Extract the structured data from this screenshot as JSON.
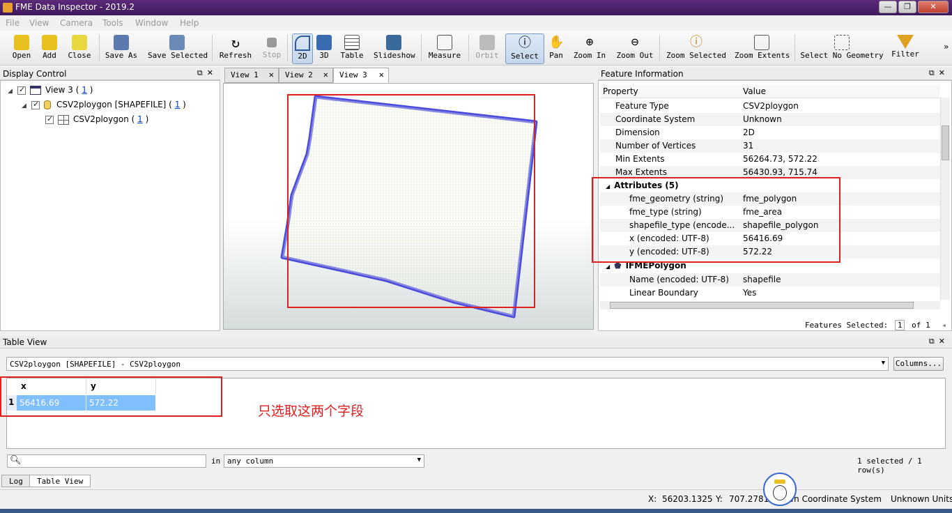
{
  "window": {
    "title": "FME Data Inspector - 2019.2",
    "min": "—",
    "max": "❐",
    "close": "✕"
  },
  "menu": [
    "File",
    "View",
    "Camera",
    "Tools",
    "Window",
    "Help"
  ],
  "toolbar": {
    "open": "Open",
    "add": "Add",
    "close": "Close",
    "save_as": "Save As",
    "save_selected": "Save Selected",
    "refresh": "Refresh",
    "stop": "Stop",
    "mode_2d": "2D",
    "mode_3d": "3D",
    "table": "Table",
    "slideshow": "Slideshow",
    "measure": "Measure",
    "orbit": "Orbit",
    "select": "Select",
    "pan": "Pan",
    "zoom_in": "Zoom In",
    "zoom_out": "Zoom Out",
    "zoom_selected": "Zoom Selected",
    "zoom_extents": "Zoom Extents",
    "select_no_geometry": "Select No Geometry",
    "filter": "Filter",
    "more": "»"
  },
  "display_control": {
    "title": "Display Control",
    "view": {
      "name": "View 3 (",
      "count": "1",
      "suffix": ")"
    },
    "dataset": {
      "name": "CSV2ploygon [SHAPEFILE] (",
      "count": "1",
      "suffix": ")"
    },
    "featuretype": {
      "name": "CSV2ploygon (",
      "count": "1",
      "suffix": ")"
    }
  },
  "view_tabs": [
    "View 1",
    "View 2",
    "View 3"
  ],
  "feature_info": {
    "title": "Feature Information",
    "header_property": "Property",
    "header_value": "Value",
    "rows": [
      {
        "property": "Feature Type",
        "value": "CSV2ploygon"
      },
      {
        "property": "Coordinate System",
        "value": "Unknown"
      },
      {
        "property": "Dimension",
        "value": "2D"
      },
      {
        "property": "Number of Vertices",
        "value": "31"
      },
      {
        "property": "Min Extents",
        "value": "56264.73, 572.22"
      },
      {
        "property": "Max Extents",
        "value": "56430.93, 715.74"
      }
    ],
    "attributes_group": "Attributes (5)",
    "attributes": [
      {
        "property": "fme_geometry (string)",
        "value": "fme_polygon"
      },
      {
        "property": "fme_type (string)",
        "value": "fme_area"
      },
      {
        "property": "shapefile_type (encode...",
        "value": "shapefile_polygon"
      },
      {
        "property": "x (encoded: UTF-8)",
        "value": "56416.69"
      },
      {
        "property": "y (encoded: UTF-8)",
        "value": "572.22"
      }
    ],
    "polygon_group": "IFMEPolygon",
    "polygon_rows": [
      {
        "property": "Name (encoded: UTF-8)",
        "value": "shapefile"
      },
      {
        "property": "Linear Boundary",
        "value": "Yes"
      }
    ],
    "features_selected_label": "Features Selected:",
    "features_selected_value": "1",
    "features_total": "of 1"
  },
  "table_view": {
    "title": "Table View",
    "source": "CSV2ploygon [SHAPEFILE] - CSV2ploygon",
    "columns_button": "Columns...",
    "columns": [
      "x",
      "y"
    ],
    "rows": [
      {
        "index": "1",
        "x": "56416.69",
        "y": "572.22"
      }
    ],
    "annotation": "只选取这两个字段",
    "search_placeholder": "",
    "in_label": "in",
    "column_filter": "any column",
    "selection_info": "1 selected / 1 row(s)"
  },
  "bottom_tabs": [
    "Log",
    "Table View"
  ],
  "status": {
    "x_label": "X:",
    "x_value": "56203.1325",
    "y_label": "Y:",
    "y_value": "707.2781",
    "coord_system": "own Coordinate System",
    "units": "Unknown Units"
  },
  "colors": {
    "polygon_outline": "#4b4bdc",
    "annotation_box": "#e0201f",
    "row_selected": "#7fbfff"
  }
}
